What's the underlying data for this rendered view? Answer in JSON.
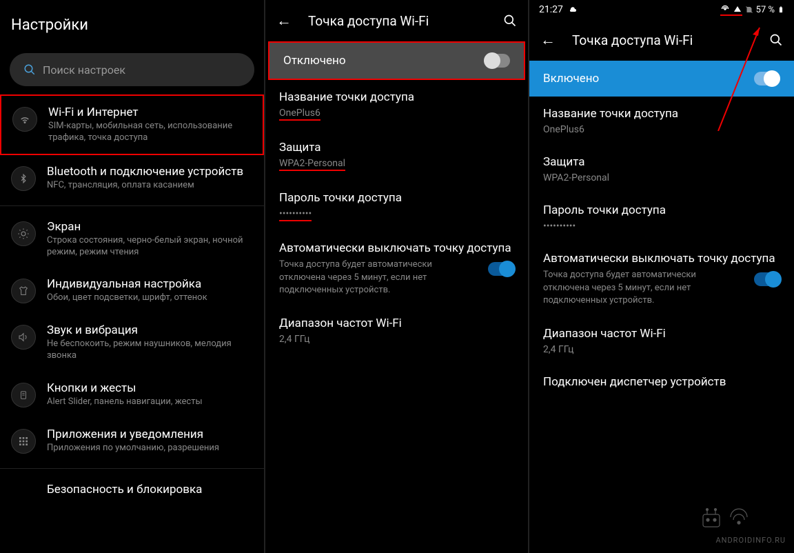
{
  "panel1": {
    "title": "Настройки",
    "search_placeholder": "Поиск настроек",
    "items": [
      {
        "title": "Wi-Fi и Интернет",
        "sub": "SIM-карты, мобильная сеть, использование трафика, точка доступа",
        "icon": "wifi"
      },
      {
        "title": "Bluetooth и подключение устройств",
        "sub": "NFC, трансляция, оплата касанием",
        "icon": "bluetooth"
      },
      {
        "title": "Экран",
        "sub": "Строка состояния, черно-белый экран, ночной режим, режим чтения",
        "icon": "brightness"
      },
      {
        "title": "Индивидуальная настройка",
        "sub": "Обои, цвет подсветки, шрифт, оттенок",
        "icon": "tshirt"
      },
      {
        "title": "Звук и вибрация",
        "sub": "Не беспокоить, режим наушников, мелодия звонка",
        "icon": "sound"
      },
      {
        "title": "Кнопки и жесты",
        "sub": "Alert Slider, панель навигации, жесты",
        "icon": "buttons"
      },
      {
        "title": "Приложения и уведомления",
        "sub": "Приложения по умолчанию, разрешения",
        "icon": "apps"
      },
      {
        "title": "Безопасность и блокировка",
        "sub": "",
        "icon": "lock"
      }
    ]
  },
  "panel2": {
    "header": "Точка доступа Wi-Fi",
    "toggle_label": "Отключено",
    "name_label": "Название точки доступа",
    "name_value": "OnePlus6",
    "security_label": "Защита",
    "security_value": "WPA2-Personal",
    "password_label": "Пароль точки доступа",
    "password_value": "••••••••••",
    "auto_title": "Автоматически выключать точку доступа",
    "auto_sub": "Точка доступа будет автоматически отключена через 5 минут, если нет подключенных устройств.",
    "band_label": "Диапазон частот Wi-Fi",
    "band_value": "2,4 ГГц"
  },
  "panel3": {
    "status_time": "21:27",
    "battery": "57 %",
    "header": "Точка доступа Wi-Fi",
    "toggle_label": "Включено",
    "name_label": "Название точки доступа",
    "name_value": "OnePlus6",
    "security_label": "Защита",
    "security_value": "WPA2-Personal",
    "password_label": "Пароль точки доступа",
    "password_value": "••••••••••",
    "auto_title": "Автоматически выключать точку доступа",
    "auto_sub": "Точка доступа будет автоматически отключена через 5 минут, если нет подключенных устройств.",
    "band_label": "Диапазон частот Wi-Fi",
    "band_value": "2,4 ГГц",
    "device_manager": "Подключен диспетчер устройств"
  },
  "watermark": "ANDROIDINFO.RU"
}
